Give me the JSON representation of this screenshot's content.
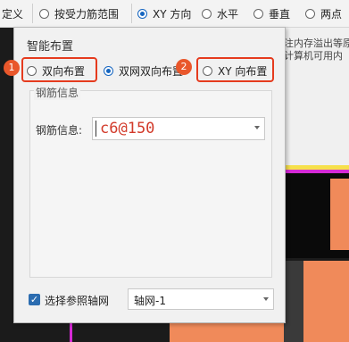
{
  "toolbar": {
    "items": [
      "定义",
      "按受力筋范围",
      "XY 方向",
      "水平",
      "垂直",
      "两点"
    ],
    "selected": "XY 方向"
  },
  "background": {
    "text_line_1": "注内存溢出等原",
    "text_line_2": "计算机可用内"
  },
  "dialog": {
    "title": "智能布置",
    "options": [
      "双向布置",
      "双网双向布置",
      "XY 向布置"
    ],
    "selected_option": "双网双向布置",
    "callouts": [
      "1",
      "2"
    ],
    "group_title": "钢筋信息",
    "field_label": "钢筋信息:",
    "field_value": "c6@150",
    "checkbox_label": "选择参照轴网",
    "checkbox_checked": true,
    "axis_grid_value": "轴网-1"
  },
  "colors": {
    "accent": "#1565c0",
    "callout_red": "#e53b1e",
    "value_red": "#d23a2a",
    "canvas_orange": "#f08a5a",
    "canvas_magenta": "#d62ad6",
    "canvas_yellow": "#f6e04b"
  }
}
